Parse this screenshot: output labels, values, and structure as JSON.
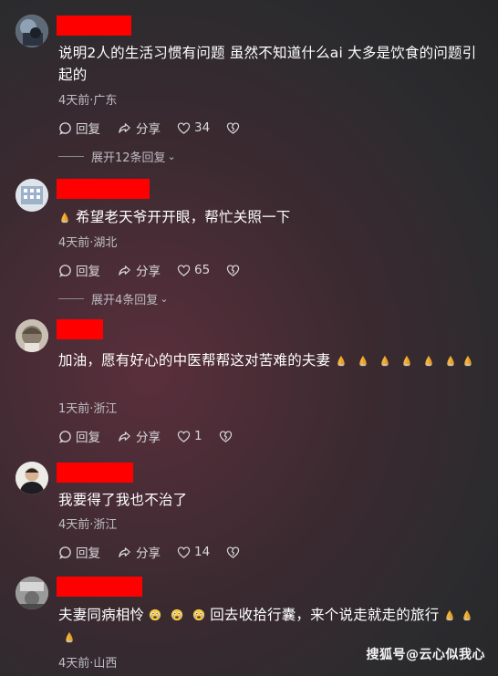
{
  "comments": [
    {
      "text": "说明2人的生活习惯有问题 虽然不知道什么ai 大多是饮食的问题引起的",
      "meta": "4天前·广东",
      "reply_label": "回复",
      "share_label": "分享",
      "likes": "34",
      "expand_label": "展开12条回复"
    },
    {
      "text": "希望老天爷开开眼，帮忙关照一下",
      "meta": "4天前·湖北",
      "reply_label": "回复",
      "share_label": "分享",
      "likes": "65",
      "expand_label": "展开4条回复"
    },
    {
      "text": "加油，愿有好心的中医帮帮这对苦难的夫妻",
      "meta": "1天前·浙江",
      "reply_label": "回复",
      "share_label": "分享",
      "likes": "1"
    },
    {
      "text": "我要得了我也不治了",
      "meta": "4天前·浙江",
      "reply_label": "回复",
      "share_label": "分享",
      "likes": "14"
    },
    {
      "text_a": "夫妻同病相怜",
      "text_b": "回去收拾行囊，来个说走就走的旅行",
      "meta": "4天前·山西"
    }
  ],
  "icons": {
    "reply": "comment-bubble-icon",
    "share": "share-arrow-icon",
    "like": "heart-icon",
    "dislike": "broken-heart-icon",
    "emoji_pray": "praying-hands-emoji",
    "emoji_cry": "crying-face-emoji"
  },
  "colors": {
    "redaction": "#ff0000",
    "meta_text": "#bfbfc4"
  },
  "watermark": "搜狐号@云心似我心"
}
